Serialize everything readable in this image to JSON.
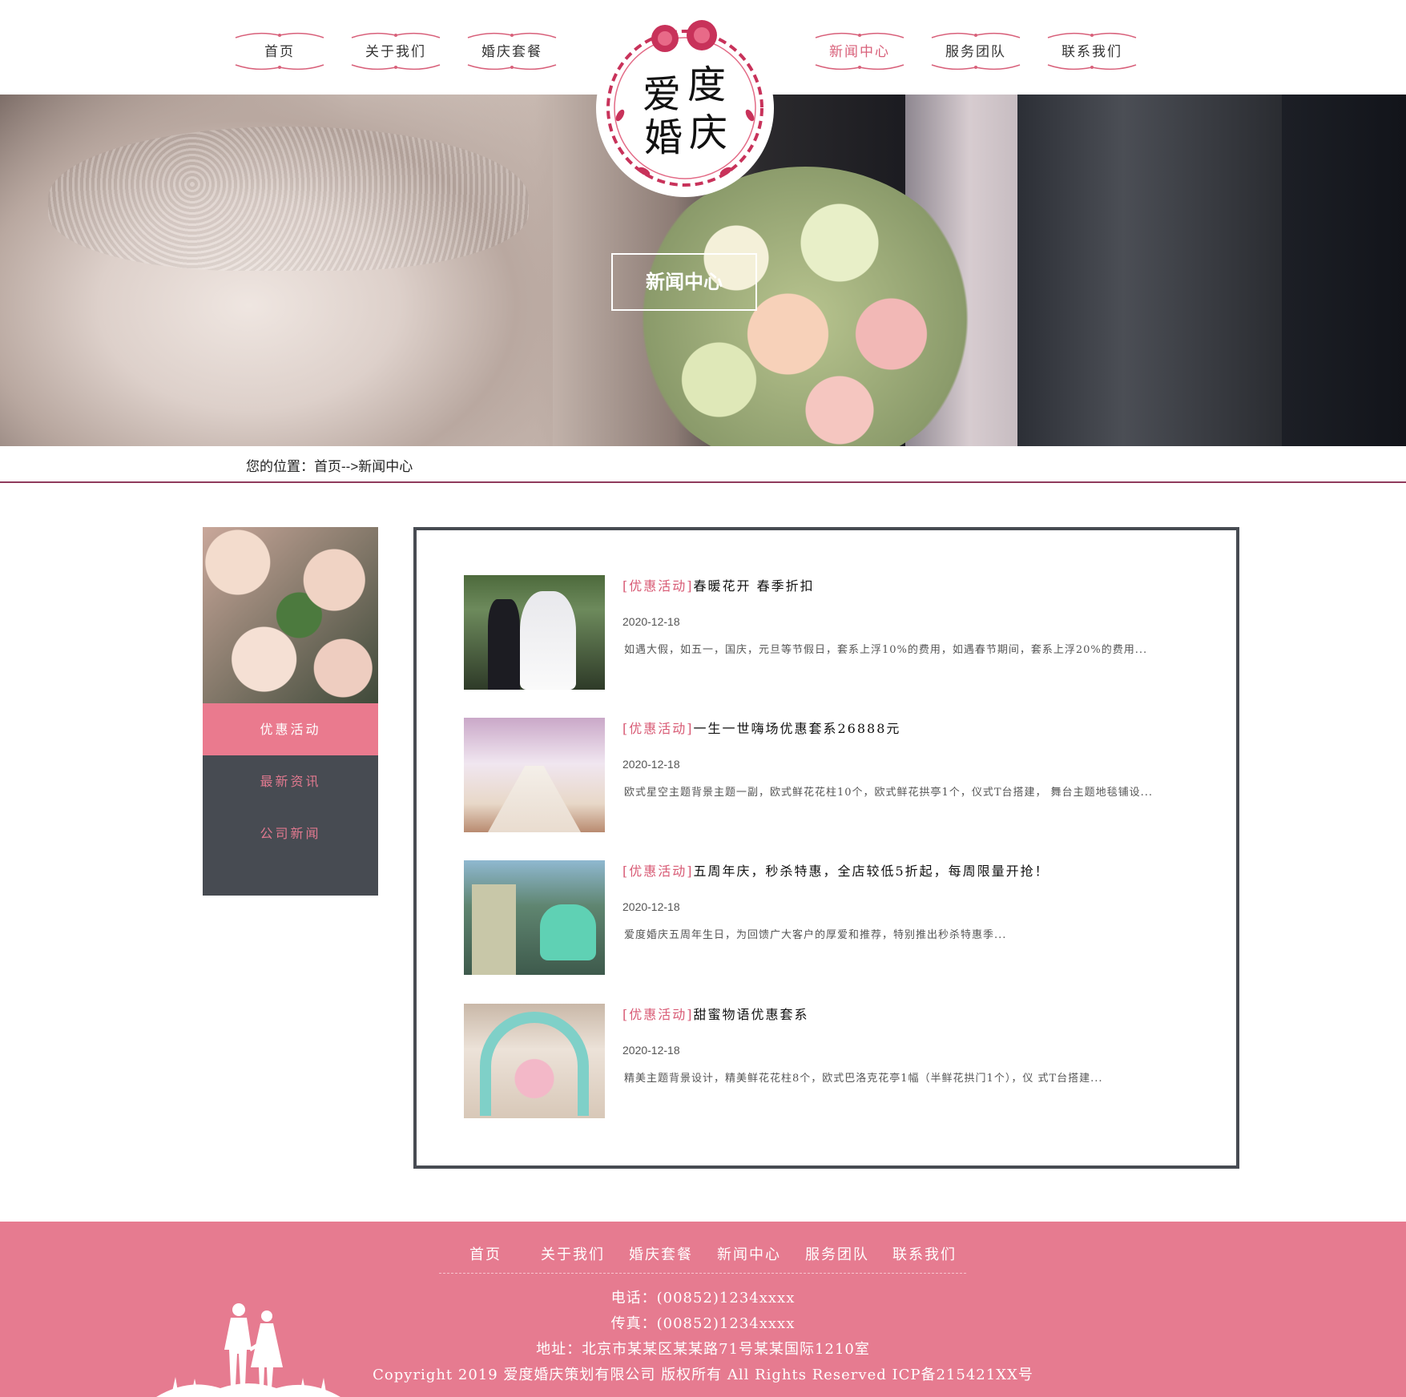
{
  "header": {
    "nav_left": [
      "首页",
      "关于我们",
      "婚庆套餐"
    ],
    "nav_right": [
      "新闻中心",
      "服务团队",
      "联系我们"
    ],
    "active": "新闻中心",
    "logo_text": [
      "爱",
      "度",
      "婚",
      "庆"
    ]
  },
  "hero": {
    "title": "新闻中心"
  },
  "breadcrumb": {
    "text": "您的位置：首页-->新闻中心"
  },
  "sidebar": {
    "items": [
      "优惠活动",
      "最新资讯",
      "公司新闻"
    ],
    "active": "优惠活动"
  },
  "news": [
    {
      "tag": "[优惠活动]",
      "title": "春暖花开 春季折扣",
      "date": "2020-12-18",
      "desc": "如遇大假，如五一，国庆，元旦等节假日，套系上浮10%的费用，如遇春节期间，套系上浮20%的费用..."
    },
    {
      "tag": "[优惠活动]",
      "title": "一生一世嗨场优惠套系26888元",
      "date": "2020-12-18",
      "desc": "欧式星空主题背景主题一副，欧式鲜花花柱10个，欧式鲜花拱亭1个，仪式T台搭建， 舞台主题地毯铺设..."
    },
    {
      "tag": "[优惠活动]",
      "title": "五周年庆，秒杀特惠，全店较低5折起，每周限量开抢！",
      "date": "2020-12-18",
      "desc": "爱度婚庆五周年生日，为回馈广大客户的厚爱和推荐，特别推出秒杀特惠季..."
    },
    {
      "tag": "[优惠活动]",
      "title": "甜蜜物语优惠套系",
      "date": "2020-12-18",
      "desc": "精美主题背景设计，精美鲜花花柱8个，欧式巴洛克花亭1幅（半鲜花拱门1个），仪 式T台搭建..."
    }
  ],
  "footer": {
    "nav": [
      "首页",
      "关于我们",
      "婚庆套餐",
      "新闻中心",
      "服务团队",
      "联系我们"
    ],
    "phone": "电话：(00852)1234xxxx",
    "fax": "传真：(00852)1234xxxx",
    "address": "地址：北京市某某区某某路71号某某国际1210室",
    "copyright": "Copyright 2019 爱度婚庆策划有限公司 版权所有 All Rights Reserved ICP备215421XX号"
  },
  "colors": {
    "accent": "#e67b90",
    "dark": "#474b52",
    "tag": "#d85a74",
    "rule": "#8f3a5c"
  }
}
